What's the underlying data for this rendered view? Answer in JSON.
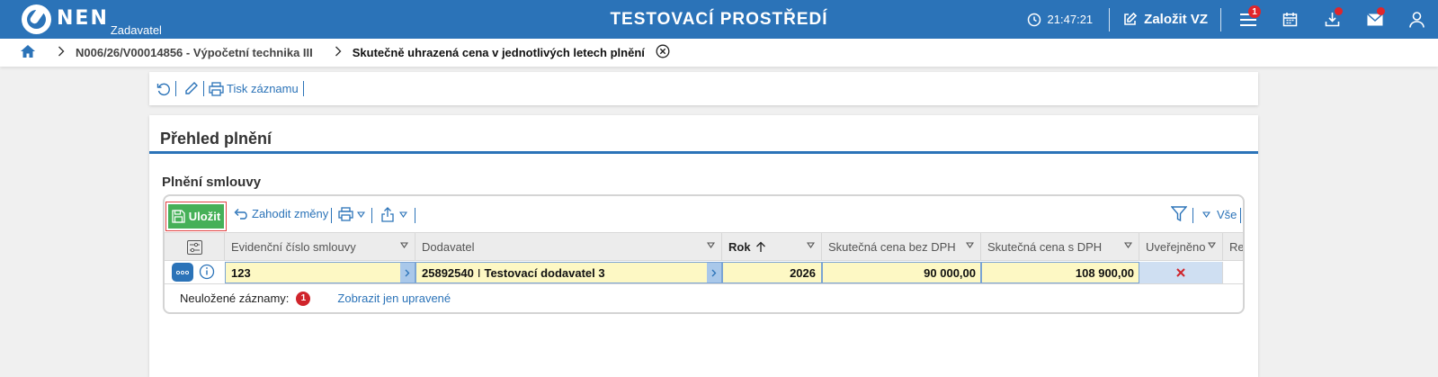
{
  "app": {
    "logo_text": "NEN",
    "logo_subtitle": "Zadavatel",
    "environment_title": "TESTOVACÍ PROSTŘEDÍ",
    "clock": "21:47:21",
    "create_label": "Založit VZ",
    "menu_badge": "1",
    "brand_color": "#2b73b8"
  },
  "breadcrumb": {
    "parent": "N006/26/V00014856 - Výpočetní technika III",
    "current": "Skutečně uhrazená cena v jednotlivých letech plnění"
  },
  "toolbar": {
    "print_label": "Tisk záznamu"
  },
  "section": {
    "title": "Přehled plnění",
    "subtitle": "Plnění smlouvy"
  },
  "grid_toolbar": {
    "save_label": "Uložit",
    "discard_label": "Zahodit změny",
    "view_label": "Vše"
  },
  "grid": {
    "columns": [
      "Evidenční číslo smlouvy",
      "Dodavatel",
      "Rok",
      "Skutečná cena bez DPH",
      "Skutečná cena s DPH",
      "Uveřejněno",
      "Re"
    ],
    "rows": [
      {
        "contract_number": "123",
        "supplier_id": "25892540",
        "supplier_sep": "I",
        "supplier_name": "Testovací dodavatel 3",
        "year": "2026",
        "price_without_vat": "90 000,00",
        "price_with_vat": "108 900,00",
        "published_icon": "red-x-icon"
      }
    ]
  },
  "grid_footer": {
    "unsaved_label": "Neuložené záznamy:",
    "unsaved_count": "1",
    "show_edited_label": "Zobrazit jen upravené"
  }
}
